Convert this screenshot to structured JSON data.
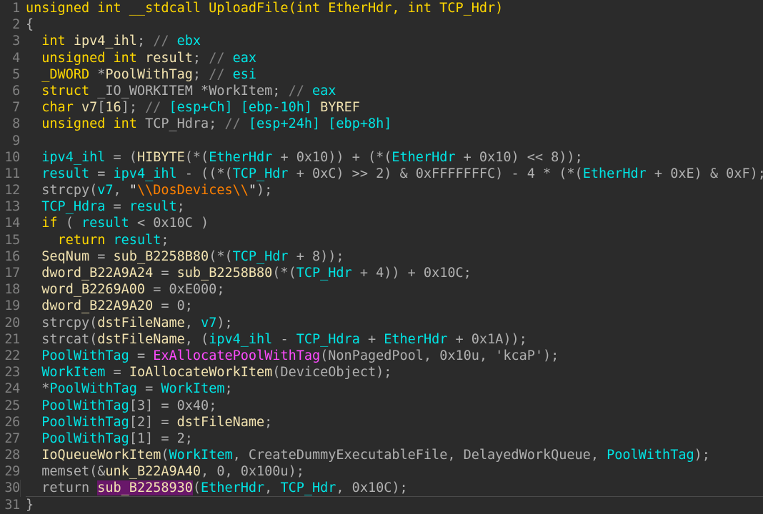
{
  "view": {
    "name": "ida-pseudocode-view",
    "background": "#2b2b2b",
    "gutter_color": "#808080",
    "colors": {
      "keyword": "#ffd700",
      "local_variable": "#00e5e5",
      "global_or_function": "#f2e3b0",
      "punctuation": "#b0b0b0",
      "library_function": "#ff4bff",
      "string": "#ff8000",
      "comment": "#808080",
      "highlight_background": "#69176a"
    },
    "current_line_number": "30",
    "highlighted_token": "sub_B2258930"
  },
  "code": {
    "lines": [
      {
        "num": "1",
        "current": false,
        "tokens": [
          {
            "t": "unsigned int __stdcall UploadFile",
            "c": "kw"
          },
          {
            "t": "(",
            "c": "kw"
          },
          {
            "t": "int EtherHdr, int TCP_Hdr",
            "c": "kw"
          },
          {
            "t": ")",
            "c": "kw"
          }
        ]
      },
      {
        "num": "2",
        "current": false,
        "tokens": [
          {
            "t": "{",
            "c": "plain"
          }
        ]
      },
      {
        "num": "3",
        "current": false,
        "tokens": [
          {
            "t": "  ",
            "c": "plain"
          },
          {
            "t": "int",
            "c": "kw"
          },
          {
            "t": " ",
            "c": "plain"
          },
          {
            "t": "ipv4_ihl",
            "c": "glob"
          },
          {
            "t": "; ",
            "c": "plain"
          },
          {
            "t": "// ",
            "c": "cmt"
          },
          {
            "t": "ebx",
            "c": "var"
          }
        ]
      },
      {
        "num": "4",
        "current": false,
        "tokens": [
          {
            "t": "  ",
            "c": "plain"
          },
          {
            "t": "unsigned int",
            "c": "kw"
          },
          {
            "t": " ",
            "c": "plain"
          },
          {
            "t": "result",
            "c": "glob"
          },
          {
            "t": "; ",
            "c": "plain"
          },
          {
            "t": "// ",
            "c": "cmt"
          },
          {
            "t": "eax",
            "c": "var"
          }
        ]
      },
      {
        "num": "5",
        "current": false,
        "tokens": [
          {
            "t": "  ",
            "c": "plain"
          },
          {
            "t": "_DWORD",
            "c": "kw"
          },
          {
            "t": " *",
            "c": "plain"
          },
          {
            "t": "PoolWithTag",
            "c": "glob"
          },
          {
            "t": "; ",
            "c": "plain"
          },
          {
            "t": "// ",
            "c": "cmt"
          },
          {
            "t": "esi",
            "c": "var"
          }
        ]
      },
      {
        "num": "6",
        "current": false,
        "tokens": [
          {
            "t": "  ",
            "c": "plain"
          },
          {
            "t": "struct",
            "c": "kw"
          },
          {
            "t": " _IO_WORKITEM *",
            "c": "plain"
          },
          {
            "t": "WorkItem",
            "c": "plain"
          },
          {
            "t": "; ",
            "c": "plain"
          },
          {
            "t": "// ",
            "c": "cmt"
          },
          {
            "t": "eax",
            "c": "var"
          }
        ]
      },
      {
        "num": "7",
        "current": false,
        "tokens": [
          {
            "t": "  ",
            "c": "plain"
          },
          {
            "t": "char",
            "c": "kw"
          },
          {
            "t": " ",
            "c": "plain"
          },
          {
            "t": "v7",
            "c": "glob"
          },
          {
            "t": "[",
            "c": "plain"
          },
          {
            "t": "16",
            "c": "glob"
          },
          {
            "t": "]; ",
            "c": "plain"
          },
          {
            "t": "// ",
            "c": "cmt"
          },
          {
            "t": "[esp+Ch]",
            "c": "var"
          },
          {
            "t": " ",
            "c": "plain"
          },
          {
            "t": "[ebp-10h]",
            "c": "var"
          },
          {
            "t": " ",
            "c": "plain"
          },
          {
            "t": "BYREF",
            "c": "glob"
          }
        ]
      },
      {
        "num": "8",
        "current": false,
        "tokens": [
          {
            "t": "  ",
            "c": "plain"
          },
          {
            "t": "unsigned int",
            "c": "kw"
          },
          {
            "t": " TCP_Hdra; ",
            "c": "plain"
          },
          {
            "t": "// ",
            "c": "cmt"
          },
          {
            "t": "[esp+24h]",
            "c": "var"
          },
          {
            "t": " ",
            "c": "plain"
          },
          {
            "t": "[ebp+8h]",
            "c": "var"
          }
        ]
      },
      {
        "num": "9",
        "current": false,
        "tokens": [
          {
            "t": "",
            "c": "plain"
          }
        ]
      },
      {
        "num": "10",
        "current": false,
        "tokens": [
          {
            "t": "  ",
            "c": "plain"
          },
          {
            "t": "ipv4_ihl",
            "c": "var"
          },
          {
            "t": " = (",
            "c": "plain"
          },
          {
            "t": "HIBYTE",
            "c": "glob"
          },
          {
            "t": "(*(",
            "c": "plain"
          },
          {
            "t": "EtherHdr",
            "c": "var"
          },
          {
            "t": " + 0x10)) + (*(",
            "c": "plain"
          },
          {
            "t": "EtherHdr",
            "c": "var"
          },
          {
            "t": " + 0x10) << 8));",
            "c": "plain"
          }
        ]
      },
      {
        "num": "11",
        "current": false,
        "tokens": [
          {
            "t": "  ",
            "c": "plain"
          },
          {
            "t": "result",
            "c": "var"
          },
          {
            "t": " = ",
            "c": "plain"
          },
          {
            "t": "ipv4_ihl",
            "c": "var"
          },
          {
            "t": " - ((*(",
            "c": "plain"
          },
          {
            "t": "TCP_Hdr",
            "c": "var"
          },
          {
            "t": " + 0xC) >> 2) & 0xFFFFFFFC) - 4 * (*(",
            "c": "plain"
          },
          {
            "t": "EtherHdr",
            "c": "var"
          },
          {
            "t": " + 0xE) & 0xF);",
            "c": "plain"
          }
        ]
      },
      {
        "num": "12",
        "current": false,
        "tokens": [
          {
            "t": "  strcpy(",
            "c": "plain"
          },
          {
            "t": "v7",
            "c": "var"
          },
          {
            "t": ", ",
            "c": "plain"
          },
          {
            "t": "\"",
            "c": "strq"
          },
          {
            "t": "\\\\DosDevices\\\\",
            "c": "str"
          },
          {
            "t": "\"",
            "c": "strq"
          },
          {
            "t": ");",
            "c": "plain"
          }
        ]
      },
      {
        "num": "13",
        "current": false,
        "tokens": [
          {
            "t": "  ",
            "c": "plain"
          },
          {
            "t": "TCP_Hdra",
            "c": "var"
          },
          {
            "t": " = ",
            "c": "plain"
          },
          {
            "t": "result",
            "c": "var"
          },
          {
            "t": ";",
            "c": "plain"
          }
        ]
      },
      {
        "num": "14",
        "current": false,
        "tokens": [
          {
            "t": "  ",
            "c": "plain"
          },
          {
            "t": "if",
            "c": "kw"
          },
          {
            "t": " ( ",
            "c": "plain"
          },
          {
            "t": "result",
            "c": "var"
          },
          {
            "t": " < 0x10C )",
            "c": "plain"
          }
        ]
      },
      {
        "num": "15",
        "current": false,
        "tokens": [
          {
            "t": "    ",
            "c": "plain"
          },
          {
            "t": "return",
            "c": "kw"
          },
          {
            "t": " ",
            "c": "plain"
          },
          {
            "t": "result",
            "c": "var"
          },
          {
            "t": ";",
            "c": "plain"
          }
        ]
      },
      {
        "num": "16",
        "current": false,
        "tokens": [
          {
            "t": "  ",
            "c": "plain"
          },
          {
            "t": "SeqNum",
            "c": "glob"
          },
          {
            "t": " = ",
            "c": "plain"
          },
          {
            "t": "sub_B2258B80",
            "c": "glob"
          },
          {
            "t": "(*(",
            "c": "plain"
          },
          {
            "t": "TCP_Hdr",
            "c": "var"
          },
          {
            "t": " + 8));",
            "c": "plain"
          }
        ]
      },
      {
        "num": "17",
        "current": false,
        "tokens": [
          {
            "t": "  ",
            "c": "plain"
          },
          {
            "t": "dword_B22A9A24",
            "c": "glob"
          },
          {
            "t": " = ",
            "c": "plain"
          },
          {
            "t": "sub_B2258B80",
            "c": "glob"
          },
          {
            "t": "(*(",
            "c": "plain"
          },
          {
            "t": "TCP_Hdr",
            "c": "var"
          },
          {
            "t": " + 4)) + 0x10C;",
            "c": "plain"
          }
        ]
      },
      {
        "num": "18",
        "current": false,
        "tokens": [
          {
            "t": "  ",
            "c": "plain"
          },
          {
            "t": "word_B2269A00",
            "c": "glob"
          },
          {
            "t": " = 0xE000;",
            "c": "plain"
          }
        ]
      },
      {
        "num": "19",
        "current": false,
        "tokens": [
          {
            "t": "  ",
            "c": "plain"
          },
          {
            "t": "dword_B22A9A20",
            "c": "glob"
          },
          {
            "t": " = 0;",
            "c": "plain"
          }
        ]
      },
      {
        "num": "20",
        "current": false,
        "tokens": [
          {
            "t": "  strcpy(",
            "c": "plain"
          },
          {
            "t": "dstFileName",
            "c": "glob"
          },
          {
            "t": ", ",
            "c": "plain"
          },
          {
            "t": "v7",
            "c": "var"
          },
          {
            "t": ");",
            "c": "plain"
          }
        ]
      },
      {
        "num": "21",
        "current": false,
        "tokens": [
          {
            "t": "  strcat(",
            "c": "plain"
          },
          {
            "t": "dstFileName",
            "c": "glob"
          },
          {
            "t": ", (",
            "c": "plain"
          },
          {
            "t": "ipv4_ihl",
            "c": "var"
          },
          {
            "t": " - ",
            "c": "plain"
          },
          {
            "t": "TCP_Hdra",
            "c": "var"
          },
          {
            "t": " + ",
            "c": "plain"
          },
          {
            "t": "EtherHdr",
            "c": "var"
          },
          {
            "t": " + 0x1A));",
            "c": "plain"
          }
        ]
      },
      {
        "num": "22",
        "current": false,
        "tokens": [
          {
            "t": "  ",
            "c": "plain"
          },
          {
            "t": "PoolWithTag",
            "c": "var"
          },
          {
            "t": " = ",
            "c": "plain"
          },
          {
            "t": "ExAllocatePoolWithTag",
            "c": "lib"
          },
          {
            "t": "(NonPagedPool, 0x10u, 'kcaP');",
            "c": "plain"
          }
        ]
      },
      {
        "num": "23",
        "current": false,
        "tokens": [
          {
            "t": "  ",
            "c": "plain"
          },
          {
            "t": "WorkItem",
            "c": "var"
          },
          {
            "t": " = ",
            "c": "plain"
          },
          {
            "t": "IoAllocateWorkItem",
            "c": "glob"
          },
          {
            "t": "(DeviceObject);",
            "c": "plain"
          }
        ]
      },
      {
        "num": "24",
        "current": false,
        "tokens": [
          {
            "t": "  *",
            "c": "plain"
          },
          {
            "t": "PoolWithTag",
            "c": "var"
          },
          {
            "t": " = ",
            "c": "plain"
          },
          {
            "t": "WorkItem",
            "c": "var"
          },
          {
            "t": ";",
            "c": "plain"
          }
        ]
      },
      {
        "num": "25",
        "current": false,
        "tokens": [
          {
            "t": "  ",
            "c": "plain"
          },
          {
            "t": "PoolWithTag",
            "c": "var"
          },
          {
            "t": "[3] = 0x40;",
            "c": "plain"
          }
        ]
      },
      {
        "num": "26",
        "current": false,
        "tokens": [
          {
            "t": "  ",
            "c": "plain"
          },
          {
            "t": "PoolWithTag",
            "c": "var"
          },
          {
            "t": "[2] = ",
            "c": "plain"
          },
          {
            "t": "dstFileName",
            "c": "glob"
          },
          {
            "t": ";",
            "c": "plain"
          }
        ]
      },
      {
        "num": "27",
        "current": false,
        "tokens": [
          {
            "t": "  ",
            "c": "plain"
          },
          {
            "t": "PoolWithTag",
            "c": "var"
          },
          {
            "t": "[1] = 2;",
            "c": "plain"
          }
        ]
      },
      {
        "num": "28",
        "current": false,
        "tokens": [
          {
            "t": "  ",
            "c": "plain"
          },
          {
            "t": "IoQueueWorkItem",
            "c": "glob"
          },
          {
            "t": "(",
            "c": "plain"
          },
          {
            "t": "WorkItem",
            "c": "var"
          },
          {
            "t": ", CreateDummyExecutableFile, DelayedWorkQueue, ",
            "c": "plain"
          },
          {
            "t": "PoolWithTag",
            "c": "var"
          },
          {
            "t": ");",
            "c": "plain"
          }
        ]
      },
      {
        "num": "29",
        "current": false,
        "tokens": [
          {
            "t": "  memset(&",
            "c": "plain"
          },
          {
            "t": "unk_B22A9A40",
            "c": "glob"
          },
          {
            "t": ", 0, 0x100u);",
            "c": "plain"
          }
        ]
      },
      {
        "num": "30",
        "current": true,
        "tokens": [
          {
            "t": "  ",
            "c": "plain"
          },
          {
            "t": "return",
            "c": "plain"
          },
          {
            "t": " ",
            "c": "plain"
          },
          {
            "t": "sub_B2258930",
            "c": "hl"
          },
          {
            "t": "(",
            "c": "plain"
          },
          {
            "t": "EtherHdr",
            "c": "var"
          },
          {
            "t": ", ",
            "c": "plain"
          },
          {
            "t": "TCP_Hdr",
            "c": "var"
          },
          {
            "t": ", 0x10C);",
            "c": "plain"
          }
        ]
      },
      {
        "num": "31",
        "current": false,
        "tokens": [
          {
            "t": "}",
            "c": "plain"
          }
        ]
      }
    ]
  }
}
